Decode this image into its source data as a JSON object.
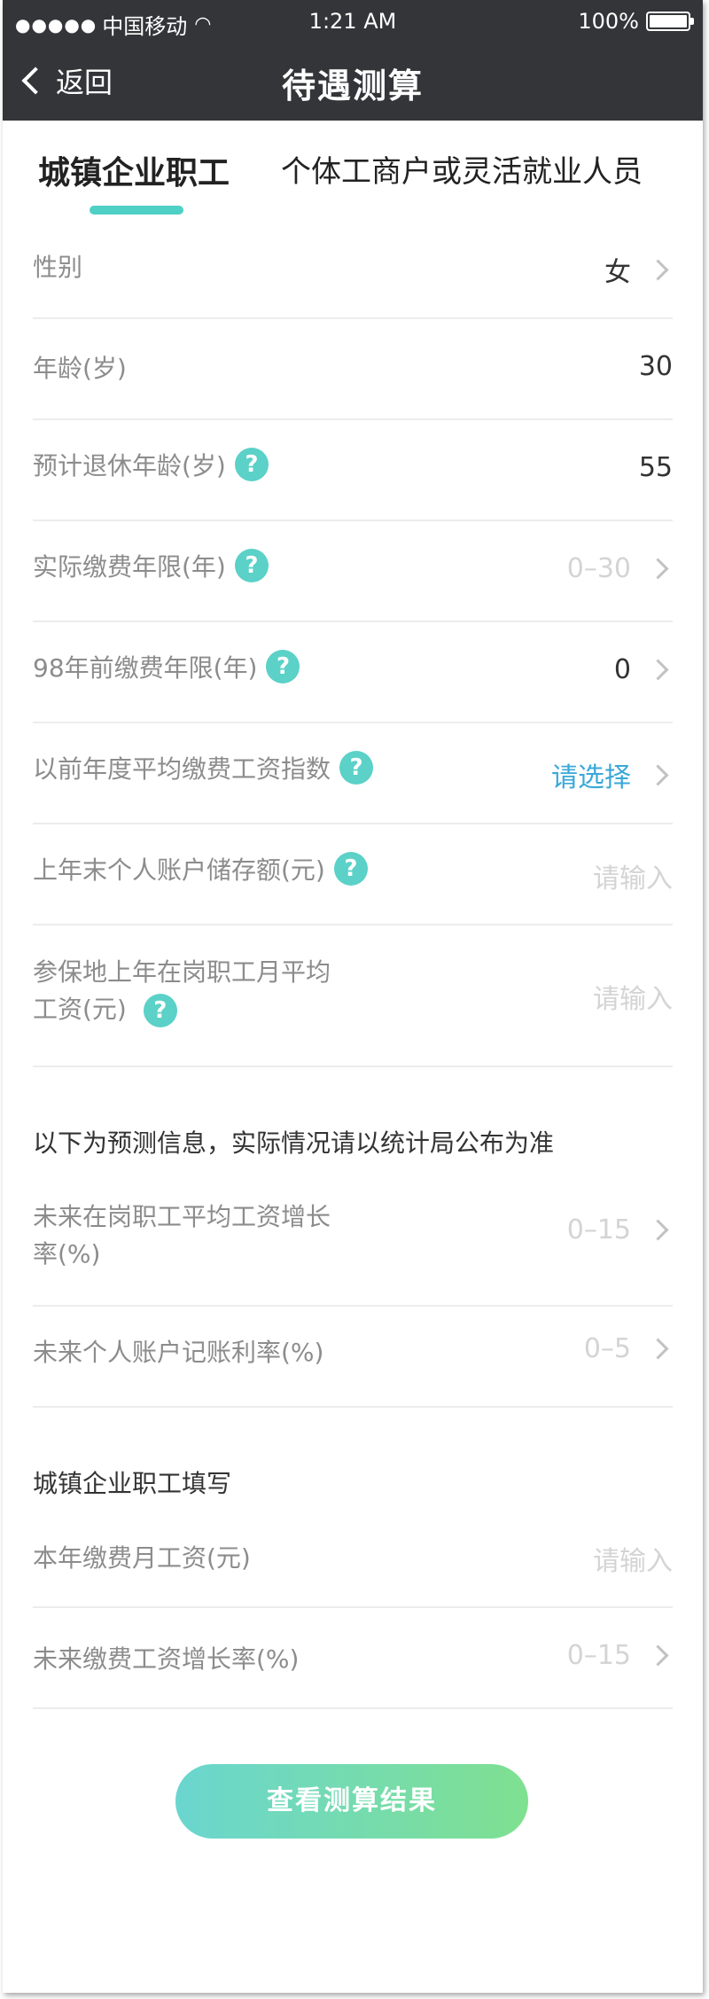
{
  "status_bar": {
    "carrier": "中国移动",
    "signal": "●●●●●",
    "time": "1:21 AM",
    "battery": "100%"
  },
  "nav": {
    "back_label": "返回",
    "title": "待遇测算"
  },
  "tabs": [
    {
      "label": "城镇企业职工",
      "active": true
    },
    {
      "label": "个体工商户或灵活就业人员",
      "active": false
    }
  ],
  "fields": {
    "gender": {
      "label": "性别",
      "value": "女"
    },
    "age": {
      "label": "年龄(岁)",
      "value": "30"
    },
    "retire_age": {
      "label": "预计退休年龄(岁)",
      "value": "55"
    },
    "years_paid": {
      "label": "实际缴费年限(年)",
      "value": "0–30"
    },
    "years_before_98": {
      "label": "98年前缴费年限(年)",
      "value": "0"
    },
    "wage_index": {
      "label": "以前年度平均缴费工资指数",
      "value": "请选择"
    },
    "account_balance": {
      "label": "上年末个人账户储存额(元)",
      "placeholder": "请输入"
    },
    "avg_wage": {
      "label_line1": "参保地上年在岗职工月平均",
      "label_line2": "工资(元)",
      "placeholder": "请输入"
    },
    "wage_growth": {
      "label_line1": "未来在岗职工平均工资增长",
      "label_line2": "率(%)",
      "value": "0–15"
    },
    "interest_rate": {
      "label": "未来个人账户记账利率(%)",
      "value": "0–5"
    },
    "monthly_wage": {
      "label": "本年缴费月工资(元)",
      "placeholder": "请输入"
    },
    "pay_growth": {
      "label": "未来缴费工资增长率(%)",
      "value": "0–15"
    }
  },
  "sections": {
    "forecast_note": "以下为预测信息，实际情况请以统计局公布为准",
    "employee_fill": "城镇企业职工填写"
  },
  "help_icon": "?",
  "submit_label": "查看测算结果",
  "colors": {
    "header_bg": "#333538",
    "accent": "#4fd0c4",
    "link": "#3aa8d8",
    "button_start": "#6ad6cf",
    "button_end": "#7fe090"
  }
}
